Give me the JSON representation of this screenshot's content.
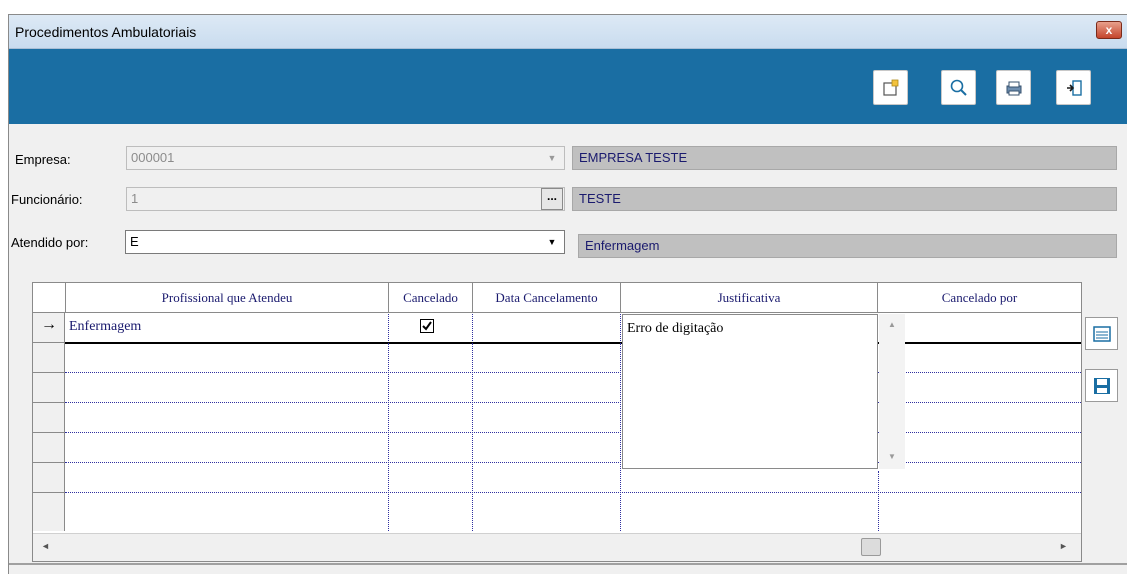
{
  "window": {
    "title": "Procedimentos Ambulatoriais",
    "close_label": "x"
  },
  "toolbar": {
    "buttons": [
      "edit-icon",
      "search-icon",
      "print-icon",
      "exit-icon"
    ]
  },
  "form": {
    "empresa": {
      "label": "Empresa:",
      "value": "000001",
      "description": "EMPRESA TESTE"
    },
    "funcionario": {
      "label": "Funcionário:",
      "value": "1",
      "dots": "...",
      "description": "TESTE"
    },
    "atendido": {
      "label": "Atendido por:",
      "value": "E",
      "description": "Enfermagem"
    }
  },
  "grid": {
    "columns": [
      "Profissional que Atendeu",
      "Cancelado",
      "Data Cancelamento",
      "Justificativa",
      "Cancelado por"
    ],
    "rows": [
      {
        "indicator": "→",
        "profissional": "Enfermagem",
        "cancelado": true,
        "data": "",
        "justificativa": "Erro de digitação",
        "cancelado_por": ""
      }
    ]
  },
  "side_buttons": [
    "list-icon",
    "save-icon"
  ]
}
